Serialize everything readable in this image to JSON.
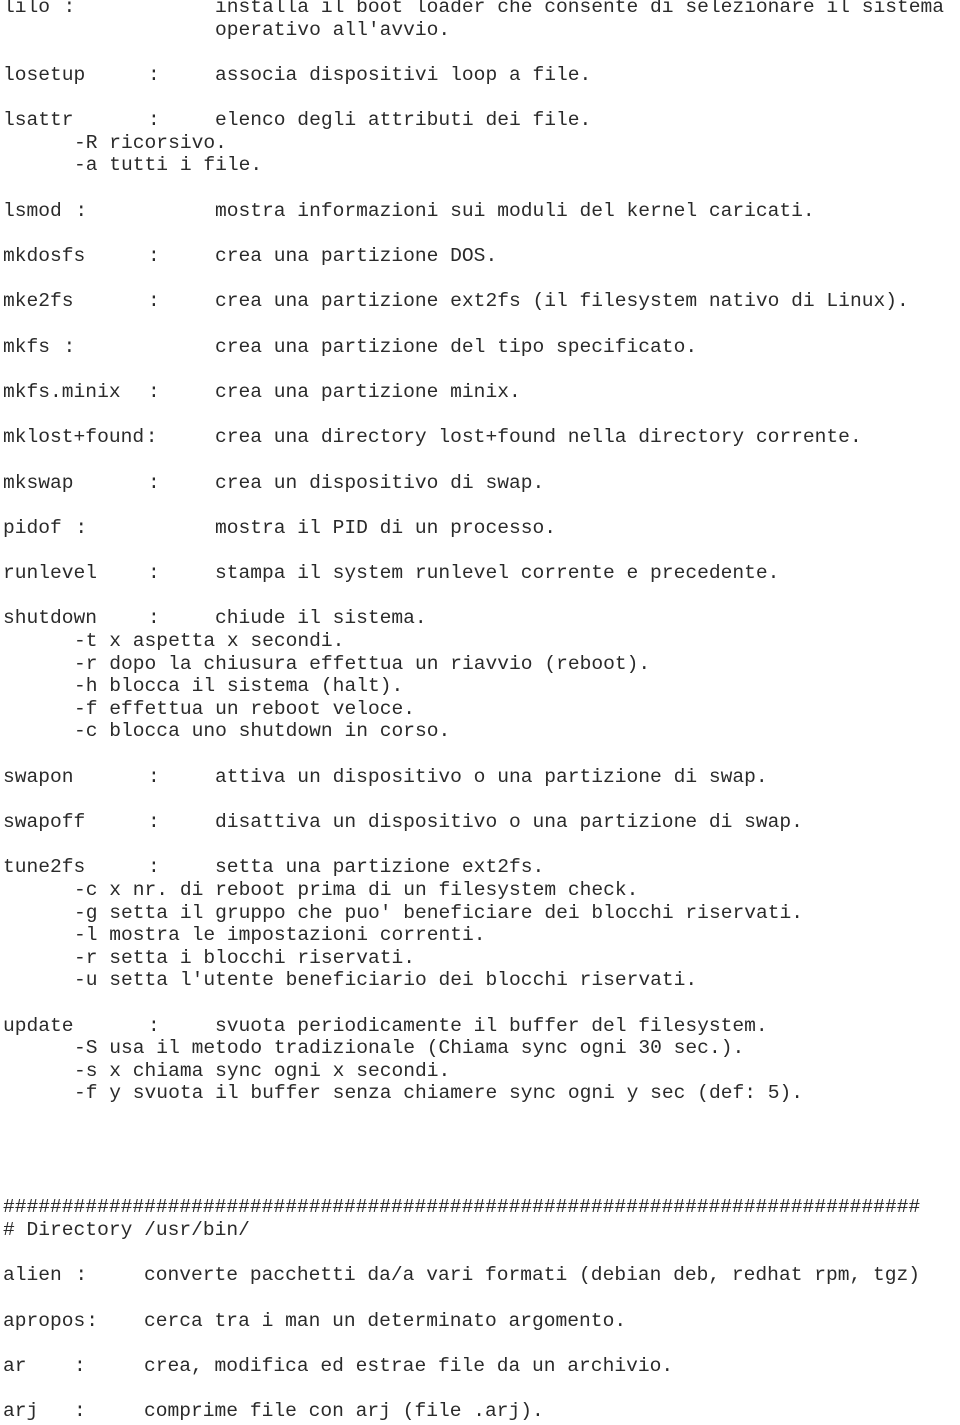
{
  "sections": [
    {
      "entries": [
        {
          "cmd": "lilo",
          "sep": ":",
          "sep_style": "tight",
          "desc": [
            "installa il boot loader che consente di selezionare il sistema",
            "operativo all'avvio."
          ],
          "options": []
        },
        {
          "cmd": "losetup",
          "sep": ":",
          "desc": [
            "associa dispositivi loop a file."
          ],
          "options": []
        },
        {
          "cmd": "lsattr",
          "sep": ":",
          "desc": [
            "elenco degli attributi dei file."
          ],
          "options": [
            "-R ricorsivo.",
            "-a tutti i file."
          ]
        },
        {
          "cmd": "lsmod",
          "sep": ":",
          "sep_style": "tight",
          "desc": [
            "mostra informazioni sui moduli del kernel caricati."
          ],
          "options": []
        },
        {
          "cmd": "mkdosfs",
          "sep": ":",
          "desc": [
            "crea una partizione DOS."
          ],
          "options": []
        },
        {
          "cmd": "mke2fs",
          "sep": ":",
          "desc": [
            "crea una partizione ext2fs (il filesystem nativo di Linux)."
          ],
          "options": []
        },
        {
          "cmd": "mkfs",
          "sep": ":",
          "sep_style": "tight",
          "desc": [
            "crea una partizione del tipo specificato."
          ],
          "options": []
        },
        {
          "cmd": "mkfs.minix",
          "sep": ":",
          "desc": [
            "crea una partizione minix."
          ],
          "options": []
        },
        {
          "cmd": "mklost+found",
          "sep": ":",
          "sep_style": "attached",
          "desc": [
            "crea una directory lost+found nella directory corrente."
          ],
          "options": []
        },
        {
          "cmd": "mkswap",
          "sep": ":",
          "desc": [
            "crea un dispositivo di swap."
          ],
          "options": []
        },
        {
          "cmd": "pidof",
          "sep": ":",
          "sep_style": "tight",
          "desc": [
            "mostra il PID di un processo."
          ],
          "options": []
        },
        {
          "cmd": "runlevel",
          "sep": ":",
          "desc": [
            "stampa il system runlevel corrente e precedente."
          ],
          "options": []
        },
        {
          "cmd": "shutdown",
          "sep": ":",
          "desc": [
            "chiude il sistema."
          ],
          "options": [
            "-t x aspetta x secondi.",
            "-r dopo la chiusura effettua un riavvio (reboot).",
            "-h blocca il sistema (halt).",
            "-f effettua un reboot veloce.",
            "-c blocca uno shutdown in corso."
          ]
        },
        {
          "cmd": "swapon",
          "sep": ":",
          "desc": [
            "attiva un dispositivo o una partizione di swap."
          ],
          "options": []
        },
        {
          "cmd": "swapoff",
          "sep": ":",
          "desc": [
            "disattiva un dispositivo o una partizione di swap."
          ],
          "options": []
        },
        {
          "cmd": "tune2fs",
          "sep": ":",
          "desc": [
            "setta una partizione ext2fs."
          ],
          "options": [
            "-c x nr. di reboot prima di un filesystem check.",
            "-g setta il gruppo che puo' beneficiare dei blocchi riservati.",
            "-l mostra le impostazioni correnti.",
            "-r setta i blocchi riservati.",
            "-u setta l'utente beneficiario dei blocchi riservati."
          ]
        },
        {
          "cmd": "update",
          "sep": ":",
          "desc": [
            "svuota periodicamente il buffer del filesystem."
          ],
          "options": [
            "-S usa il metodo tradizionale (Chiama sync ogni 30 sec.).",
            "-s x chiama sync ogni x secondi.",
            "-f y svuota il buffer senza chiamere sync ogni y sec (def: 5)."
          ]
        }
      ]
    }
  ],
  "separator": "##############################################################################",
  "directory_header": "# Directory /usr/bin/",
  "usr_bin_entries": [
    {
      "cmd": "alien",
      "sep": ":",
      "sep_style": "tight",
      "desc": "converte pacchetti da/a vari formati (debian deb, redhat rpm, tgz)"
    },
    {
      "cmd": "apropos",
      "sep": ":",
      "sep_style": "attached",
      "desc": "cerca tra i man un determinato argomento."
    },
    {
      "cmd": "ar",
      "sep": ":",
      "desc": "crea, modifica ed estrae file da un archivio."
    },
    {
      "cmd": "arj",
      "sep": ":",
      "desc": "comprime file con arj (file .arj)."
    }
  ]
}
